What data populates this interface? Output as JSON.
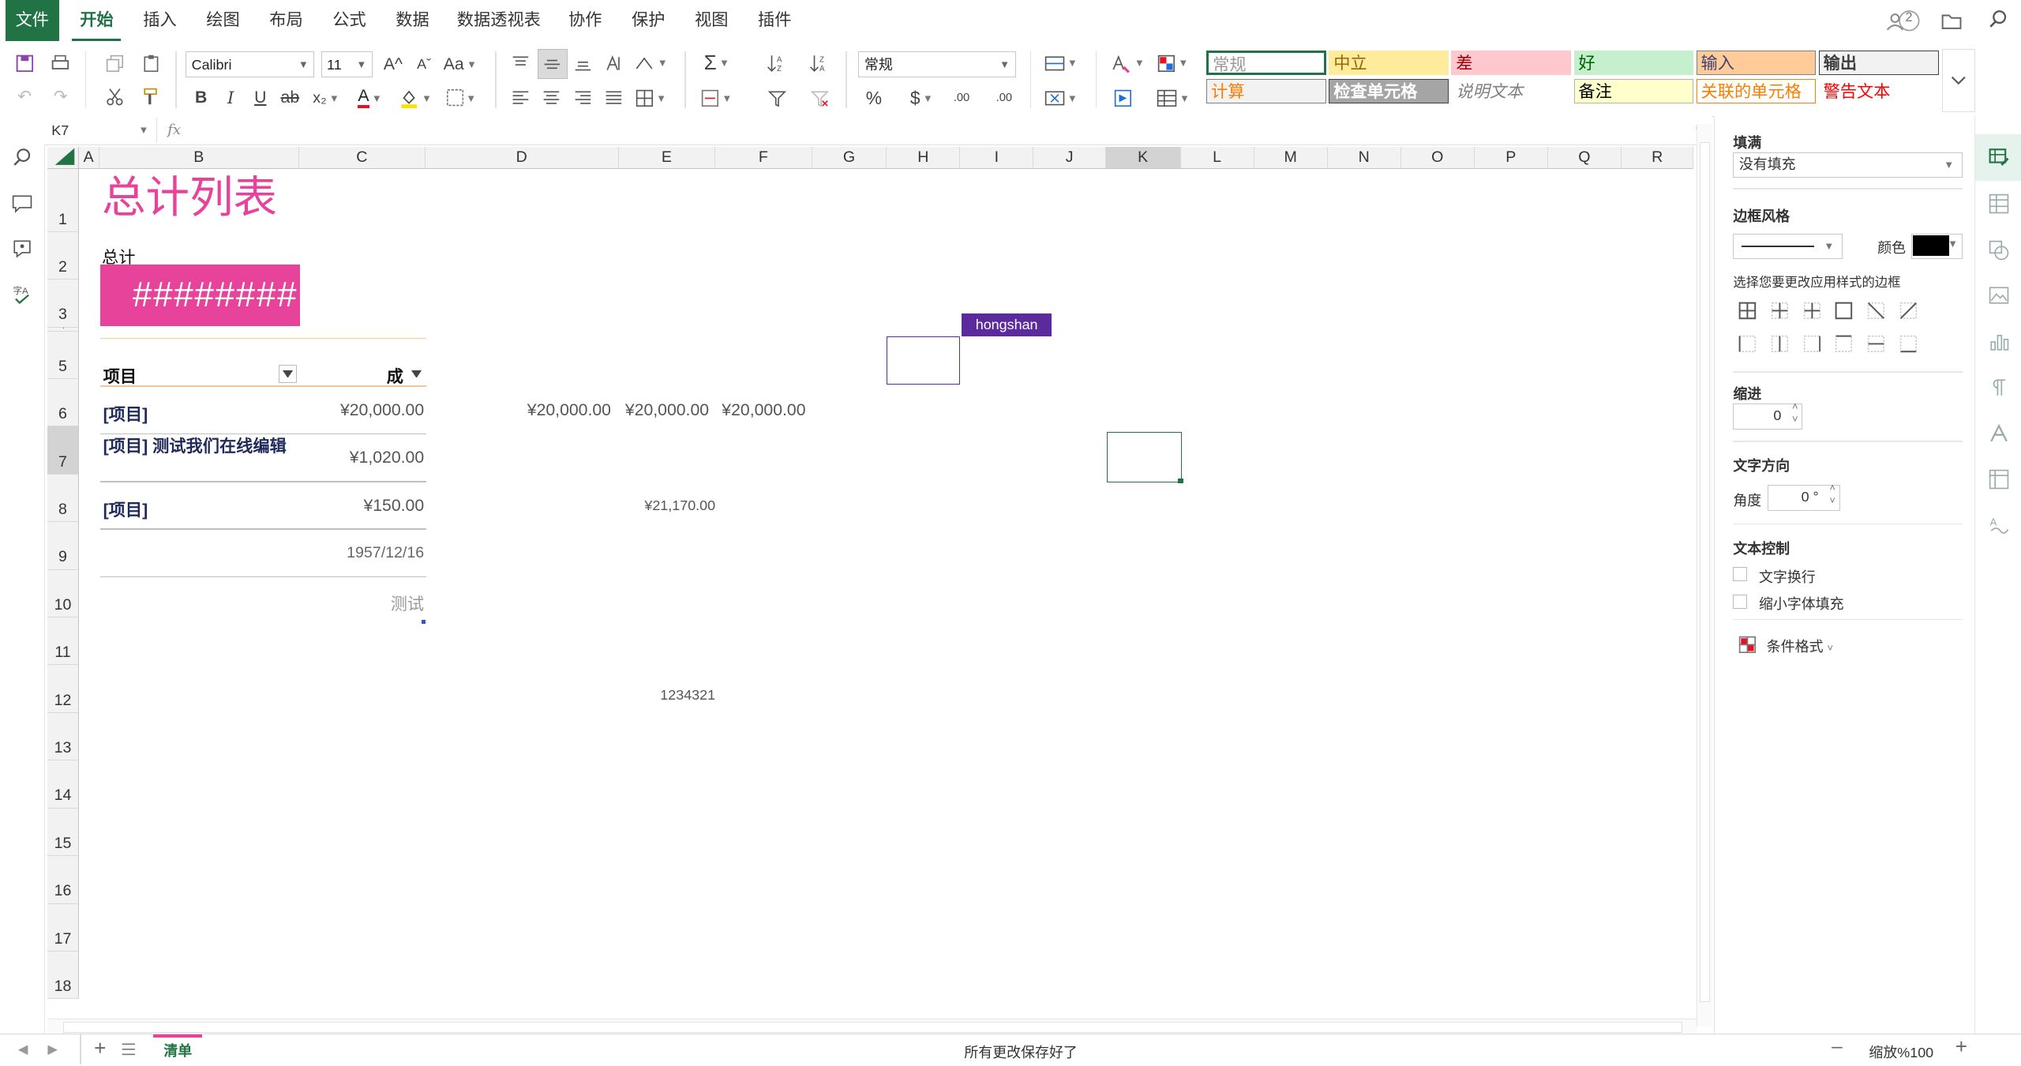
{
  "menu": {
    "file": "文件",
    "tabs": [
      "开始",
      "插入",
      "绘图",
      "布局",
      "公式",
      "数据",
      "数据透视表",
      "协作",
      "保护",
      "视图",
      "插件"
    ],
    "active_tab": "开始",
    "collab_count": "2"
  },
  "ribbon": {
    "font_name": "Calibri",
    "font_size": "11",
    "number_format": "常规",
    "percent": "%",
    "currency": "$",
    "bold": "B",
    "italic": "I",
    "underline": "U",
    "strike": "ab",
    "subscript": "x₂",
    "font_color_letter": "A",
    "grow_font": "A^",
    "shrink_font": "Aˇ",
    "case": "Aa",
    "sum": "Σ",
    "inc_decimal": ".00",
    "dec_decimal": ".00",
    "cell_styles": [
      {
        "label": "常规",
        "bg": "#ffffff",
        "fg": "#9a9a9a",
        "border": "#217346"
      },
      {
        "label": "中立",
        "bg": "#ffeb9c",
        "fg": "#9c6500",
        "border": "#ffeb9c"
      },
      {
        "label": "差",
        "bg": "#ffc7ce",
        "fg": "#9c0006",
        "border": "#ffc7ce"
      },
      {
        "label": "好",
        "bg": "#c6efce",
        "fg": "#006100",
        "border": "#c6efce"
      },
      {
        "label": "输入",
        "bg": "#ffcc99",
        "fg": "#3f3f76",
        "border": "#7f7f7f"
      },
      {
        "label": "输出",
        "bg": "#f2f2f2",
        "fg": "#3f3f3f",
        "border": "#3f3f3f"
      },
      {
        "label": "计算",
        "bg": "#f2f2f2",
        "fg": "#fa7d00",
        "border": "#7f7f7f"
      },
      {
        "label": "检查单元格",
        "bg": "#a5a5a5",
        "fg": "#ffffff",
        "border": "#3f3f3f"
      },
      {
        "label": "说明文本",
        "bg": "#ffffff",
        "fg": "#7f7f7f",
        "border": "#ffffff"
      },
      {
        "label": "备注",
        "bg": "#ffffcc",
        "fg": "#000000",
        "border": "#b2b2b2"
      },
      {
        "label": "关联的单元格",
        "bg": "#ffffff",
        "fg": "#fa7d00",
        "border": "#ff8001"
      },
      {
        "label": "警告文本",
        "bg": "#ffffff",
        "fg": "#ff0000",
        "border": "#ffffff"
      }
    ]
  },
  "formula_bar": {
    "name_box": "K7",
    "fx": "fx",
    "content": ""
  },
  "sheet": {
    "columns": [
      "A",
      "B",
      "C",
      "D",
      "E",
      "F",
      "G",
      "H",
      "I",
      "J",
      "K",
      "L",
      "M",
      "N",
      "O",
      "P",
      "Q",
      "R"
    ],
    "selected_column": "K",
    "rows": [
      "1",
      "2",
      "3",
      "4",
      "5",
      "6",
      "7",
      "8",
      "9",
      "10",
      "11",
      "12",
      "13",
      "14",
      "15",
      "16",
      "17",
      "18"
    ],
    "selected_row": "7",
    "title": "总计列表",
    "total_label": "总计",
    "total_value": "########",
    "header_item": "项目",
    "header_cost": "成",
    "items": [
      {
        "name": "[项目]",
        "value": "¥20,000.00"
      },
      {
        "name": "[项目] 测试我们在线编辑",
        "value": "¥1,020.00"
      },
      {
        "name": "[项目]",
        "value": "¥150.00"
      }
    ],
    "date_value": "1957/12/16",
    "test_value": "测试",
    "d6": "¥20,000.00",
    "e6": "¥20,000.00",
    "f6": "¥20,000.00",
    "e8": "¥21,170.00",
    "e12": "1234321",
    "collaborator": "hongshan",
    "accent": "#e8439a",
    "collab_color": "#5b2a9d"
  },
  "panel": {
    "fill_title": "填满",
    "fill_value": "没有填充",
    "border_title": "边框风格",
    "color_label": "颜色",
    "border_hint": "选择您要更改应用样式的边框",
    "indent_title": "缩进",
    "indent_value": "0",
    "direction_title": "文字方向",
    "angle_label": "角度",
    "angle_value": "0 °",
    "text_control_title": "文本控制",
    "wrap_text": "文字换行",
    "shrink_fit": "缩小字体填充",
    "conditional_format": "条件格式"
  },
  "status": {
    "sheet_tab": "清单",
    "save_status": "所有更改保存好了",
    "zoom": "缩放%100"
  }
}
